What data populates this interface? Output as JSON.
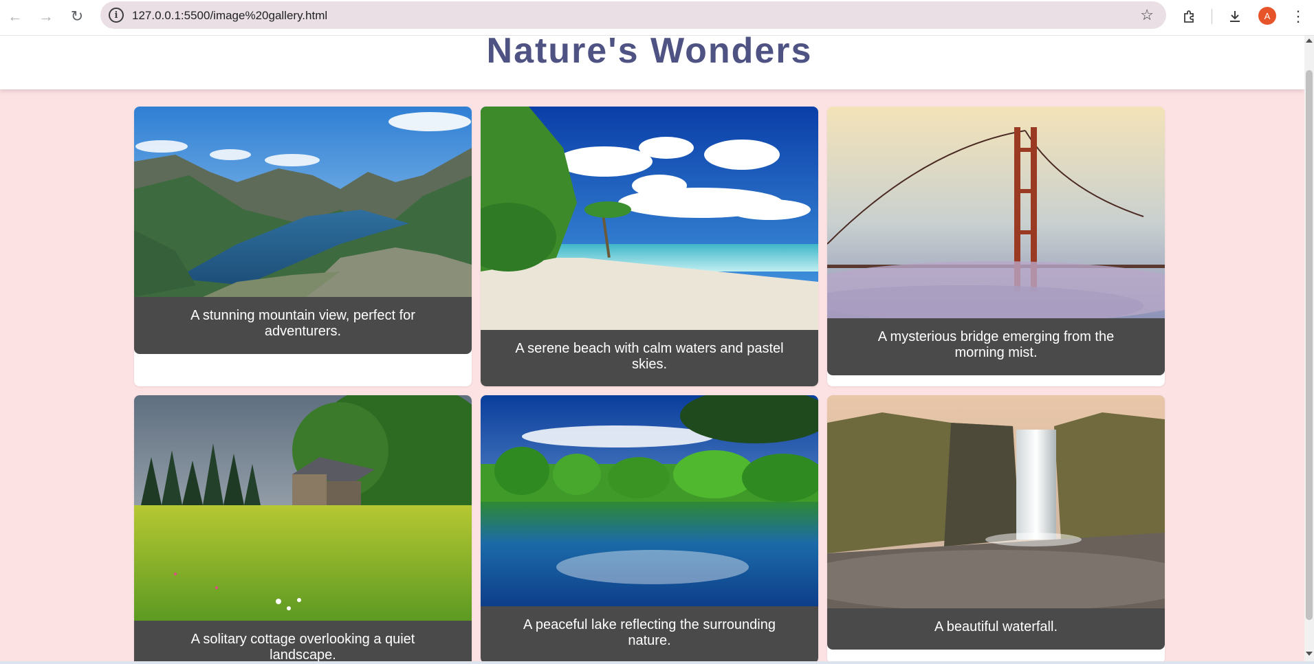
{
  "browser": {
    "url": "127.0.0.1:5500/image%20gallery.html",
    "avatar_initial": "A",
    "icons": [
      "back-arrow-icon",
      "forward-arrow-icon",
      "reload-icon",
      "site-info-icon",
      "bookmark-star-icon",
      "extensions-icon",
      "download-icon",
      "more-menu-icon"
    ]
  },
  "page": {
    "title": "Nature's Wonders",
    "colors": {
      "background": "#fde2e4",
      "title": "#4e5383",
      "caption_bg": "#4a4a4a",
      "caption_text": "#ffffff"
    }
  },
  "gallery": [
    {
      "caption": "A stunning mountain view, perfect for adventurers."
    },
    {
      "caption": "A serene beach with calm waters and pastel skies."
    },
    {
      "caption": "A mysterious bridge emerging from the morning mist."
    },
    {
      "caption": "A solitary cottage overlooking a quiet landscape."
    },
    {
      "caption": "A peaceful lake reflecting the surrounding nature."
    },
    {
      "caption": "A beautiful waterfall."
    }
  ]
}
